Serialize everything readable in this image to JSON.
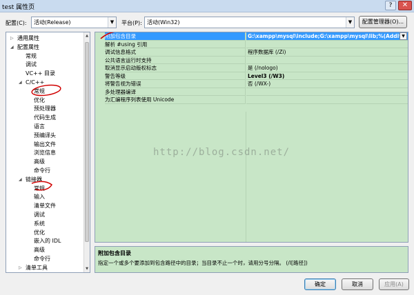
{
  "window": {
    "title": "test 属性页",
    "help_label": "?",
    "close_label": "✕"
  },
  "config": {
    "label": "配置(C):",
    "value": "活动(Release)"
  },
  "platform": {
    "label": "平台(P):",
    "value": "活动(Win32)"
  },
  "config_manager_label": "配置管理器(O)...",
  "tree": [
    {
      "label": "通用属性",
      "toggle": "▷"
    },
    {
      "label": "配置属性",
      "toggle": "◢"
    },
    {
      "label": "常规",
      "toggle": ""
    },
    {
      "label": "调试",
      "toggle": ""
    },
    {
      "label": "VC++ 目录",
      "toggle": ""
    },
    {
      "label": "C/C++",
      "toggle": "◢"
    },
    {
      "label": "常规",
      "toggle": ""
    },
    {
      "label": "优化",
      "toggle": ""
    },
    {
      "label": "预处理器",
      "toggle": ""
    },
    {
      "label": "代码生成",
      "toggle": ""
    },
    {
      "label": "语言",
      "toggle": ""
    },
    {
      "label": "预编译头",
      "toggle": ""
    },
    {
      "label": "输出文件",
      "toggle": ""
    },
    {
      "label": "浏览信息",
      "toggle": ""
    },
    {
      "label": "高级",
      "toggle": ""
    },
    {
      "label": "命令行",
      "toggle": ""
    },
    {
      "label": "链接器",
      "toggle": "◢"
    },
    {
      "label": "常规",
      "toggle": ""
    },
    {
      "label": "输入",
      "toggle": ""
    },
    {
      "label": "清单文件",
      "toggle": ""
    },
    {
      "label": "调试",
      "toggle": ""
    },
    {
      "label": "系统",
      "toggle": ""
    },
    {
      "label": "优化",
      "toggle": ""
    },
    {
      "label": "嵌入的 IDL",
      "toggle": ""
    },
    {
      "label": "高级",
      "toggle": ""
    },
    {
      "label": "命令行",
      "toggle": ""
    },
    {
      "label": "清单工具",
      "toggle": "▷"
    }
  ],
  "grid": [
    {
      "name": "附加包含目录",
      "value": "G:\\xampp\\mysql\\include;G:\\xampp\\mysql\\lib;%(Additi",
      "bold": true,
      "selected": true,
      "dropdown": "▼"
    },
    {
      "name": "解析 #using 引用",
      "value": "",
      "bold": false,
      "selected": false,
      "dropdown": ""
    },
    {
      "name": "调试信息格式",
      "value": "程序数据库 (/Zi)",
      "bold": false,
      "selected": false,
      "dropdown": ""
    },
    {
      "name": "公共语言运行时支持",
      "value": "",
      "bold": false,
      "selected": false,
      "dropdown": ""
    },
    {
      "name": "取消显示启动版权标志",
      "value": "是 (/nologo)",
      "bold": false,
      "selected": false,
      "dropdown": ""
    },
    {
      "name": "警告等级",
      "value": "Level3 (/W3)",
      "bold": true,
      "selected": false,
      "dropdown": ""
    },
    {
      "name": "将警告视为错误",
      "value": "否 (/WX-)",
      "bold": false,
      "selected": false,
      "dropdown": ""
    },
    {
      "name": "多处理器编译",
      "value": "",
      "bold": false,
      "selected": false,
      "dropdown": ""
    },
    {
      "name": "为汇编程序列表使用 Unicode",
      "value": "",
      "bold": false,
      "selected": false,
      "dropdown": ""
    }
  ],
  "description": {
    "title": "附加包含目录",
    "text": "指定一个或多个要添加到包含路径中的目录；当目录不止一个时，请用分号分隔。      (/I[路径])"
  },
  "watermark": "http://blog.csdn.net/",
  "buttons": {
    "ok": "确定",
    "cancel": "取消",
    "apply": "应用(A)"
  },
  "colors": {
    "grid_bg": "#c8e6c7",
    "selection": "#3399ff",
    "annotation": "#d00000"
  }
}
